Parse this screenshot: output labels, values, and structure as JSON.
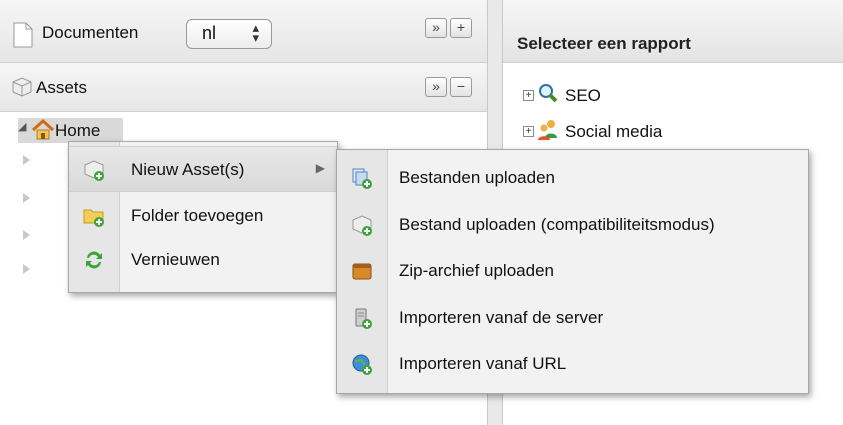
{
  "left": {
    "documents_label": "Documenten",
    "language_select": "nl",
    "assets_label": "Assets",
    "tree_root": "Home"
  },
  "right": {
    "header_title": "Selecteer een rapport",
    "reports": [
      "SEO",
      "Social media"
    ]
  },
  "context_menu": {
    "items": [
      "Nieuw Asset(s)",
      "Folder toevoegen",
      "Vernieuwen"
    ]
  },
  "submenu": {
    "items": [
      "Bestanden uploaden",
      "Bestand uploaden (compatibiliteitsmodus)",
      "Zip-archief uploaden",
      "Importeren vanaf de server",
      "Importeren vanaf URL"
    ]
  }
}
